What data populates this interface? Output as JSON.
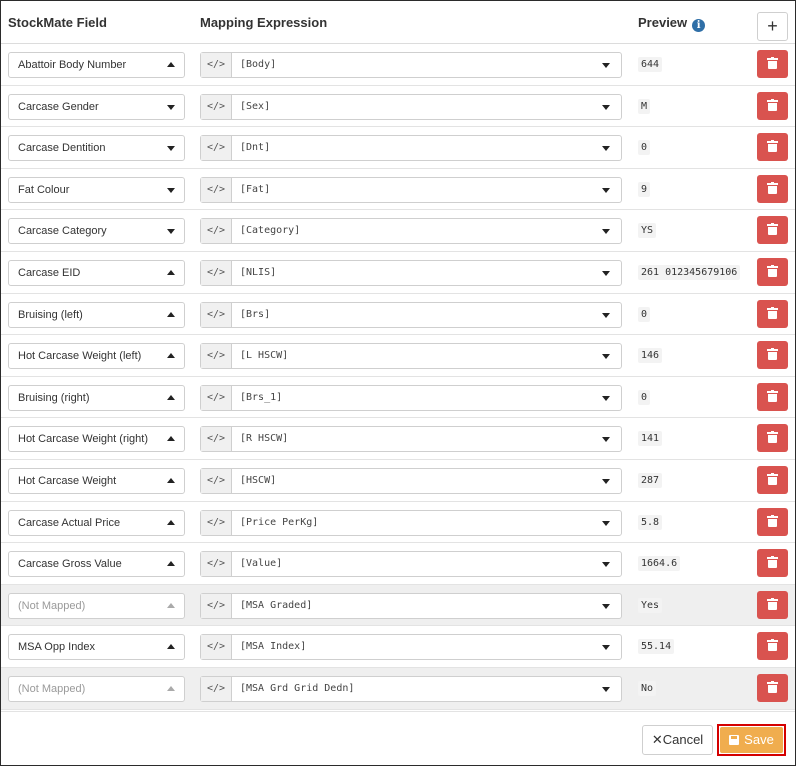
{
  "header": {
    "field_col": "StockMate Field",
    "expr_col": "Mapping Expression",
    "preview_col": "Preview",
    "info_glyph": "i",
    "add_glyph": "+"
  },
  "code_glyph": "</>",
  "rows": [
    {
      "field": "Abattoir Body Number",
      "field_caret": "up",
      "expression": "[Body]",
      "preview": "644",
      "mapped": true
    },
    {
      "field": "Carcase Gender",
      "field_caret": "down",
      "expression": "[Sex]",
      "preview": "M",
      "mapped": true
    },
    {
      "field": "Carcase Dentition",
      "field_caret": "down",
      "expression": "[Dnt]",
      "preview": "0",
      "mapped": true
    },
    {
      "field": "Fat Colour",
      "field_caret": "down",
      "expression": "[Fat]",
      "preview": "9",
      "mapped": true
    },
    {
      "field": "Carcase Category",
      "field_caret": "down",
      "expression": "[Category]",
      "preview": "YS",
      "mapped": true
    },
    {
      "field": "Carcase EID",
      "field_caret": "up",
      "expression": "[NLIS]",
      "preview": "261 012345679106",
      "mapped": true
    },
    {
      "field": "Bruising (left)",
      "field_caret": "up",
      "expression": "[Brs]",
      "preview": "0",
      "mapped": true
    },
    {
      "field": "Hot Carcase Weight (left)",
      "field_caret": "up",
      "expression": "[L HSCW]",
      "preview": "146",
      "mapped": true
    },
    {
      "field": "Bruising (right)",
      "field_caret": "up",
      "expression": "[Brs_1]",
      "preview": "0",
      "mapped": true
    },
    {
      "field": "Hot Carcase Weight (right)",
      "field_caret": "up",
      "expression": "[R HSCW]",
      "preview": "141",
      "mapped": true
    },
    {
      "field": "Hot Carcase Weight",
      "field_caret": "up",
      "expression": "[HSCW]",
      "preview": "287",
      "mapped": true
    },
    {
      "field": "Carcase Actual Price",
      "field_caret": "up",
      "expression": "[Price PerKg]",
      "preview": "5.8",
      "mapped": true
    },
    {
      "field": "Carcase Gross Value",
      "field_caret": "up",
      "expression": "[Value]",
      "preview": "1664.6",
      "mapped": true
    },
    {
      "field": "(Not Mapped)",
      "field_caret": "up",
      "expression": "[MSA Graded]",
      "preview": "Yes",
      "mapped": false
    },
    {
      "field": "MSA Opp Index",
      "field_caret": "up",
      "expression": "[MSA Index]",
      "preview": "55.14",
      "mapped": true
    },
    {
      "field": "(Not Mapped)",
      "field_caret": "up",
      "expression": "[MSA Grd Grid Dedn]",
      "preview": "No",
      "mapped": false
    }
  ],
  "footer": {
    "cancel_label": "Cancel",
    "cancel_glyph": "✕",
    "save_label": "Save"
  },
  "colors": {
    "delete": "#d9534f",
    "save": "#f0ad4e",
    "highlight": "#d40000",
    "info": "#2f6fa7"
  }
}
